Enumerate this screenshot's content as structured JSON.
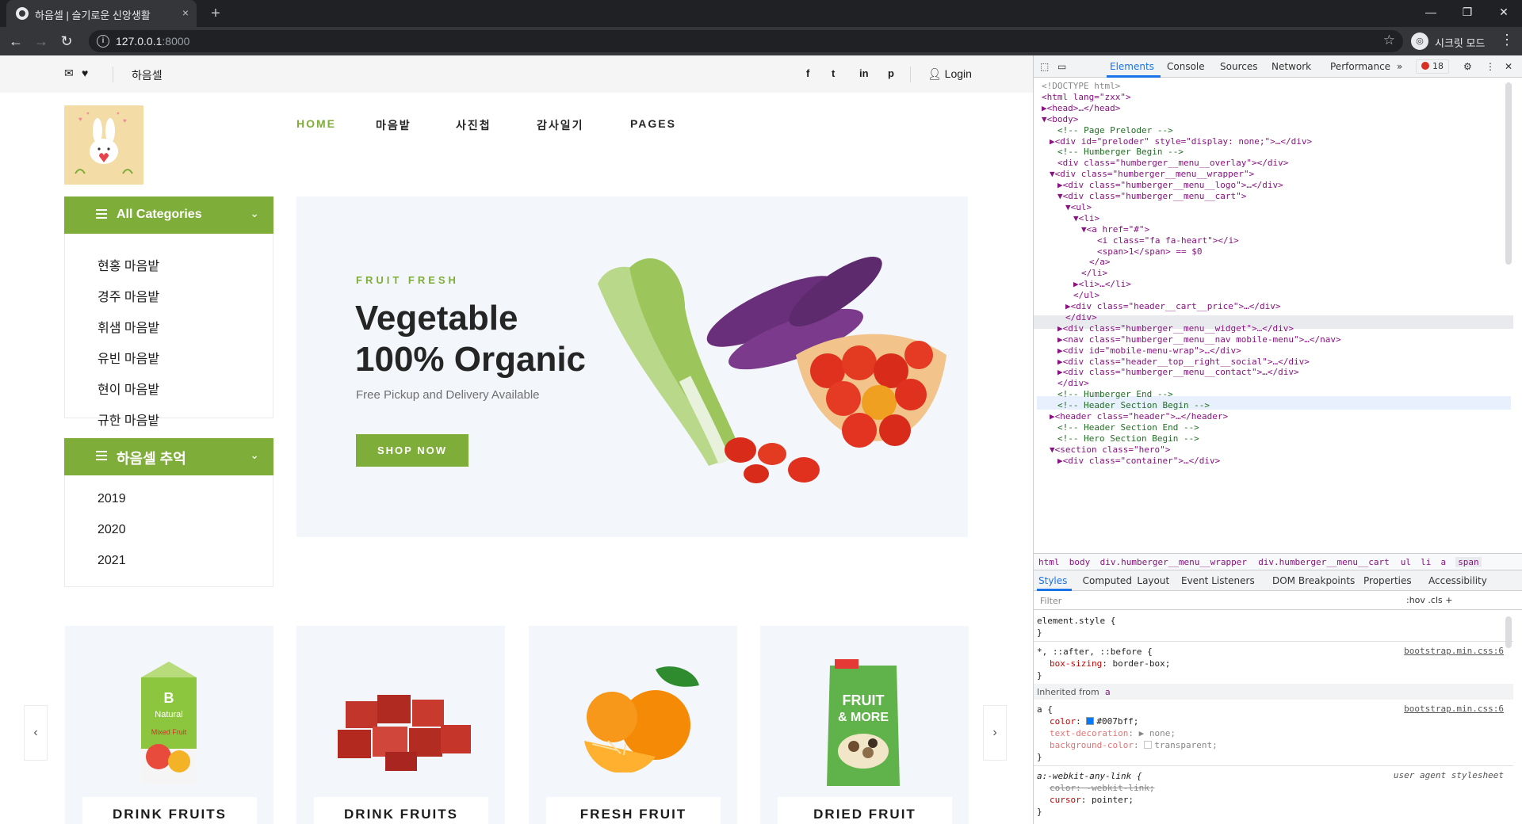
{
  "browser": {
    "tab_title": "하음셀 | 슬기로운 신앙생활",
    "tab_close": "×",
    "new_tab": "+",
    "url_host": "127.0.0.1",
    "url_port": ":8000",
    "incognito_label": "시크릿 모드",
    "window_controls": [
      "—",
      "❐",
      "✕"
    ]
  },
  "site": {
    "topbar": {
      "brand": "하음셀",
      "social": [
        "f",
        "t",
        "in",
        "p"
      ],
      "login": "Login"
    },
    "nav": [
      {
        "label": "HOME",
        "active": true
      },
      {
        "label": "마음밭",
        "active": false
      },
      {
        "label": "사진첩",
        "active": false
      },
      {
        "label": "감사일기",
        "active": false
      },
      {
        "label": "PAGES",
        "active": false
      }
    ],
    "categories": {
      "title": "All Categories",
      "items": [
        "현홍 마음밭",
        "경주 마음밭",
        "휘샘 마음밭",
        "유빈 마음밭",
        "현이 마음밭",
        "규한 마음밭"
      ]
    },
    "memories": {
      "title": "하음셀 추억",
      "items": [
        "2019",
        "2020",
        "2021"
      ]
    },
    "hero": {
      "kicker": "FRUIT FRESH",
      "title_line1": "Vegetable",
      "title_line2": "100% Organic",
      "subtitle": "Free Pickup and Delivery Available",
      "button": "SHOP NOW"
    },
    "cards": [
      "DRINK FRUITS",
      "DRINK FRUITS",
      "FRESH FRUIT",
      "DRIED FRUIT"
    ],
    "card_images": [
      "juice-carton-image",
      "meat-cubes-image",
      "orange-image",
      "nut-pack-image"
    ],
    "card_pack_text": [
      "B",
      "Natural",
      "Mixed Fruit",
      "FRUIT",
      "& MORE"
    ],
    "carousel_prev": "‹",
    "carousel_next": "›"
  },
  "devtools": {
    "tabs": [
      "Elements",
      "Console",
      "Sources",
      "Network",
      "Performance"
    ],
    "more": "»",
    "error_count": "18",
    "dom_lines": [
      {
        "indent": 0,
        "kind": "doc",
        "text": "<!DOCTYPE html>"
      },
      {
        "indent": 0,
        "kind": "tag",
        "text": "<html lang=\"zxx\">"
      },
      {
        "indent": 0,
        "kind": "tag",
        "text": "▶<head>…</head>"
      },
      {
        "indent": 0,
        "kind": "tag",
        "text": "▼<body>"
      },
      {
        "indent": 2,
        "kind": "cm",
        "text": "<!-- Page Preloder -->"
      },
      {
        "indent": 1,
        "kind": "tag",
        "text": "▶<div id=\"preloder\" style=\"display: none;\">…</div>"
      },
      {
        "indent": 2,
        "kind": "cm",
        "text": "<!-- Humberger Begin -->"
      },
      {
        "indent": 2,
        "kind": "tag",
        "text": "<div class=\"humberger__menu__overlay\"></div>"
      },
      {
        "indent": 1,
        "kind": "tag",
        "text": "▼<div class=\"humberger__menu__wrapper\">"
      },
      {
        "indent": 2,
        "kind": "tag",
        "text": "▶<div class=\"humberger__menu__logo\">…</div>"
      },
      {
        "indent": 2,
        "kind": "tag",
        "text": "▼<div class=\"humberger__menu__cart\">"
      },
      {
        "indent": 3,
        "kind": "tag",
        "text": "▼<ul>"
      },
      {
        "indent": 4,
        "kind": "tag",
        "text": "▼<li>"
      },
      {
        "indent": 5,
        "kind": "tag",
        "text": "▼<a href=\"#\">"
      },
      {
        "indent": 7,
        "kind": "tag",
        "text": "<i class=\"fa fa-heart\"></i>"
      },
      {
        "indent": 7,
        "kind": "tag",
        "text": "<span>1</span> == $0"
      },
      {
        "indent": 6,
        "kind": "tag",
        "text": "</a>"
      },
      {
        "indent": 5,
        "kind": "tag",
        "text": "</li>"
      },
      {
        "indent": 4,
        "kind": "tag",
        "text": "▶<li>…</li>"
      },
      {
        "indent": 4,
        "kind": "tag",
        "text": "</ul>"
      },
      {
        "indent": 3,
        "kind": "tag",
        "text": "▶<div class=\"header__cart__price\">…</div>"
      },
      {
        "indent": 3,
        "kind": "tag",
        "text": "</div>"
      },
      {
        "indent": 2,
        "kind": "tag",
        "text": "▶<div class=\"humberger__menu__widget\">…</div>"
      },
      {
        "indent": 2,
        "kind": "tag",
        "text": "▶<nav class=\"humberger__menu__nav mobile-menu\">…</nav>"
      },
      {
        "indent": 2,
        "kind": "tag",
        "text": "▶<div id=\"mobile-menu-wrap\">…</div>"
      },
      {
        "indent": 2,
        "kind": "tag",
        "text": "▶<div class=\"header__top__right__social\">…</div>"
      },
      {
        "indent": 2,
        "kind": "tag",
        "text": "▶<div class=\"humberger__menu__contact\">…</div>"
      },
      {
        "indent": 2,
        "kind": "tag",
        "text": "</div>"
      },
      {
        "indent": 2,
        "kind": "cm",
        "text": "<!-- Humberger End -->"
      },
      {
        "indent": 2,
        "kind": "cm",
        "text": "<!-- Header Section Begin -->"
      },
      {
        "indent": 1,
        "kind": "tag",
        "text": "▶<header class=\"header\">…</header>"
      },
      {
        "indent": 2,
        "kind": "cm",
        "text": "<!-- Header Section End -->"
      },
      {
        "indent": 2,
        "kind": "cm",
        "text": "<!-- Hero Section Begin -->"
      },
      {
        "indent": 1,
        "kind": "tag",
        "text": "▼<section class=\"hero\">"
      },
      {
        "indent": 2,
        "kind": "tag",
        "text": "▶<div class=\"container\">…</div>"
      }
    ],
    "breadcrumbs": [
      "html",
      "body",
      "div.humberger__menu__wrapper",
      "div.humberger__menu__cart",
      "ul",
      "li",
      "a",
      "span"
    ],
    "sub_tabs": [
      "Styles",
      "Computed",
      "Layout",
      "Event Listeners",
      "DOM Breakpoints",
      "Properties",
      "Accessibility"
    ],
    "filter_placeholder": "Filter",
    "filter_tools": ":hov  .cls  +",
    "styles": {
      "element_style": "element.style {",
      "close": "}",
      "rule1_selector": "*, ::after, ::before {",
      "rule1_prop": "box-sizing",
      "rule1_val": "border-box;",
      "rule1_src": "bootstrap.min.css:6",
      "inherited_label": "Inherited from",
      "inherited_el": "a",
      "rule2_selector": "a {",
      "rule2_src": "bootstrap.min.css:6",
      "rule2_color_prop": "color",
      "rule2_color_val": "#007bff;",
      "rule2_td_prop": "text-decoration",
      "rule2_td_val": "▶ none;",
      "rule2_bg_prop": "background-color",
      "rule2_bg_val": "transparent;",
      "rule3_selector": "a:-webkit-any-link {",
      "rule3_src": "user agent stylesheet",
      "rule3_color": "color: -webkit-link;",
      "rule3_cursor_prop": "cursor",
      "rule3_cursor_val": "pointer;"
    }
  },
  "colors": {
    "accent": "#7fad39",
    "devtools_blue": "#1a73e8",
    "link_blue": "#007bff"
  }
}
